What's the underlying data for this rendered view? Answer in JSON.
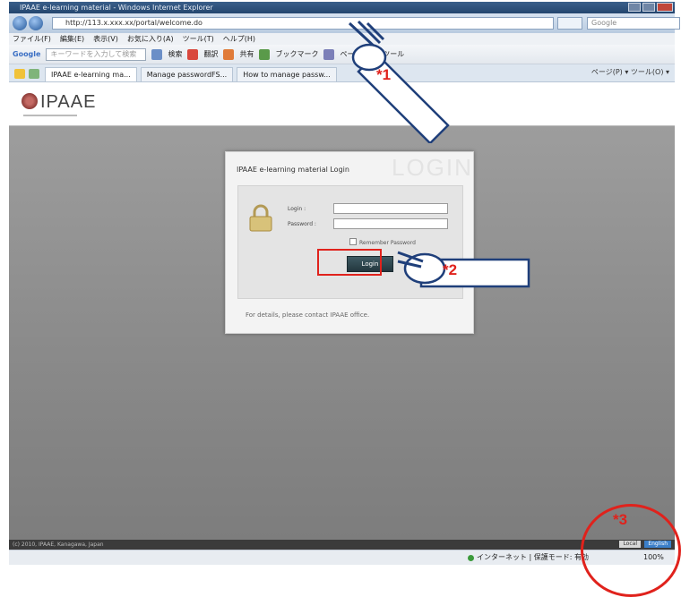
{
  "browser": {
    "window_title": "IPAAE e-learning material - Windows Internet Explorer",
    "address": "http://113.x.xxx.xx/portal/welcome.do",
    "search_placeholder": "Google",
    "menu": [
      "ファイル(F)",
      "編集(E)",
      "表示(V)",
      "お気に入り(A)",
      "ツール(T)",
      "ヘルプ(H)"
    ],
    "google_label": "Google",
    "google_placeholder": "キーワードを入力して検索",
    "toolbar_items": [
      "検索",
      "翻訳",
      "共有",
      "ブックマーク",
      "ページ",
      "ツール"
    ],
    "tabs": [
      "IPAAE e-learning ma...",
      "Manage passwordFS...",
      "How to manage passw..."
    ],
    "right_commands": "ページ(P) ▾  ツール(O) ▾",
    "status_text": "インターネット | 保護モード: 有効",
    "zoom": "100%"
  },
  "page": {
    "logo_text": "IPAAE",
    "footer_text": "(c) 2010, IPAAE, Kanagawa, Japan",
    "lang_options": [
      "Local",
      "English"
    ]
  },
  "login": {
    "title": "IPAAE e-learning material Login",
    "watermark": "LOGIN",
    "login_label": "Login :",
    "password_label": "Password :",
    "login_value": "",
    "password_value": "",
    "remember_label": "Remember Password",
    "button_label": "Login",
    "note": "For details, please contact IPAAE office."
  },
  "annotations": [
    "*1",
    "*2",
    "*3"
  ],
  "colors": {
    "annotation_red": "#e0221c",
    "login_button": "#2b4047",
    "background_gray": "#8f8f8f"
  }
}
